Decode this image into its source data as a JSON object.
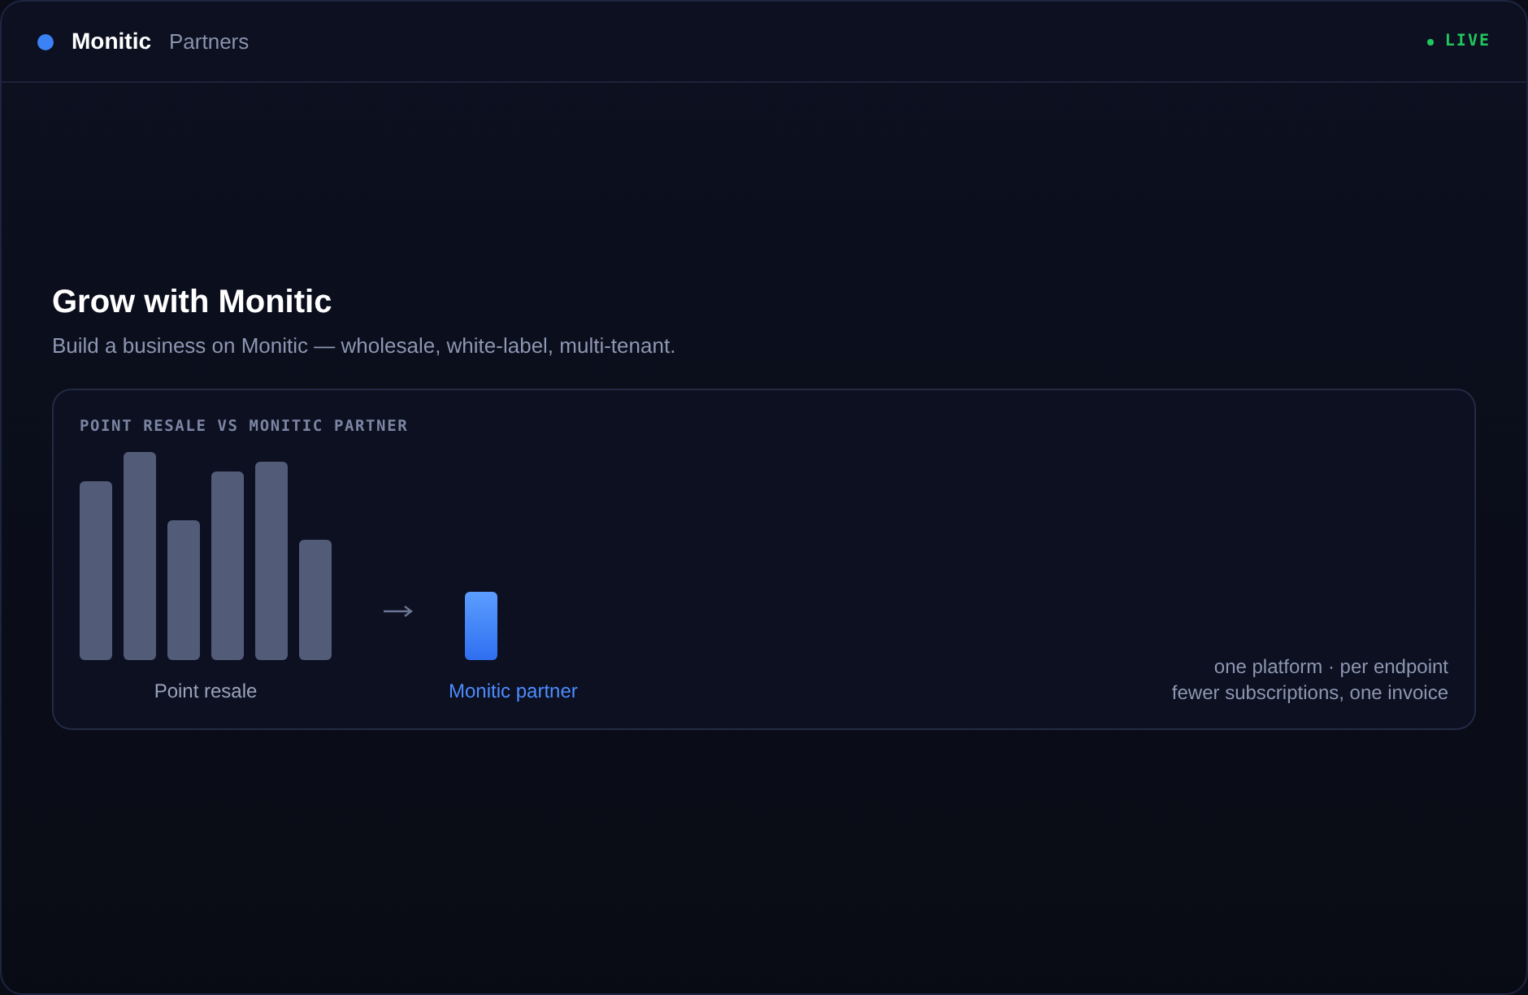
{
  "header": {
    "brand": "Monitic",
    "section": "Partners",
    "status": "LIVE"
  },
  "hero": {
    "title": "Grow with Monitic",
    "subtitle": "Build a business on Monitic — wholesale, white-label, multi-tenant."
  },
  "comparison": {
    "heading": "POINT RESALE VS MONITIC PARTNER",
    "left_label": "Point resale",
    "right_label": "Monitic partner",
    "notes": [
      "one platform · per endpoint",
      "fewer subscriptions, one invoice"
    ]
  }
}
